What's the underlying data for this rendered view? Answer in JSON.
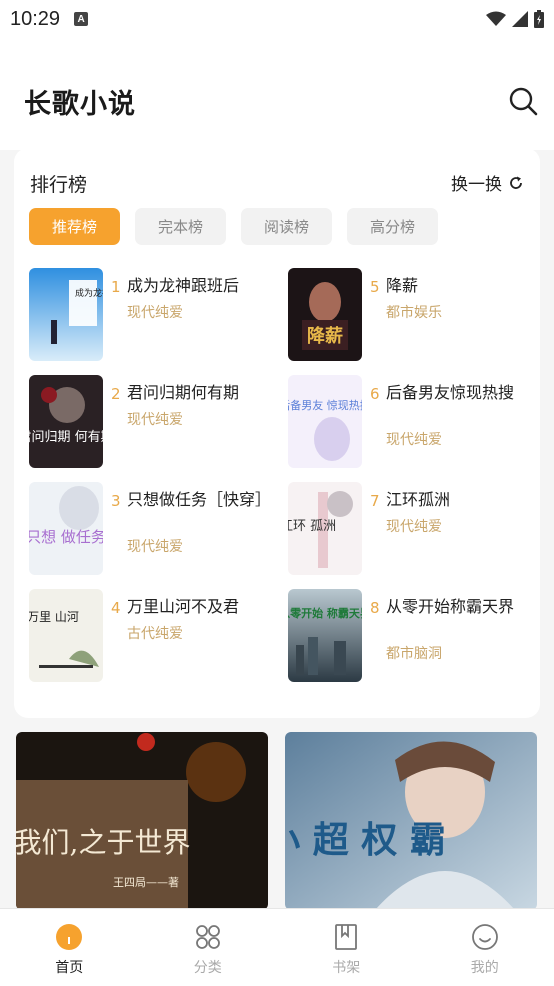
{
  "status_bar": {
    "time": "10:29",
    "notification_letter": "A"
  },
  "header": {
    "app_title": "长歌小说"
  },
  "ranking": {
    "title": "排行榜",
    "swap_label": "换一换",
    "tabs": [
      {
        "label": "推荐榜",
        "active": true
      },
      {
        "label": "完本榜",
        "active": false
      },
      {
        "label": "阅读榜",
        "active": false
      },
      {
        "label": "高分榜",
        "active": false
      }
    ],
    "books": [
      {
        "rank": "1",
        "title": "成为龙神跟班后",
        "genre": "现代纯爱",
        "cover_text": "成为龙神 跟班后"
      },
      {
        "rank": "5",
        "title": "降薪",
        "genre": "都市娱乐",
        "cover_text": "降薪"
      },
      {
        "rank": "2",
        "title": "君问归期何有期",
        "genre": "现代纯爱",
        "cover_text": "君问归期 何有期"
      },
      {
        "rank": "6",
        "title": "后备男友惊现热搜",
        "genre": "现代纯爱",
        "cover_text": "后备男友 惊现热搜"
      },
      {
        "rank": "3",
        "title": "只想做任务［快穿］",
        "genre": "现代纯爱",
        "cover_text": "只想 做任务"
      },
      {
        "rank": "7",
        "title": "江环孤洲",
        "genre": "现代纯爱",
        "cover_text": "江环 孤洲"
      },
      {
        "rank": "4",
        "title": "万里山河不及君",
        "genre": "古代纯爱",
        "cover_text": "万里 山河"
      },
      {
        "rank": "8",
        "title": "从零开始称霸天界",
        "genre": "都市脑洞",
        "cover_text": "从零开始 称霸天界"
      }
    ]
  },
  "banners": [
    {
      "cover_text": "我们,之于世界",
      "author": "王四局——著"
    },
    {
      "cover_text": "小 超 权 霸"
    }
  ],
  "bottom_nav": [
    {
      "label": "首页",
      "icon": "home-icon",
      "active": true
    },
    {
      "label": "分类",
      "icon": "category-icon",
      "active": false
    },
    {
      "label": "书架",
      "icon": "bookshelf-icon",
      "active": false
    },
    {
      "label": "我的",
      "icon": "profile-icon",
      "active": false
    }
  ],
  "colors": {
    "accent": "#f6a22e",
    "genre": "#c9a66b",
    "rank_number": "#e8a94a"
  }
}
